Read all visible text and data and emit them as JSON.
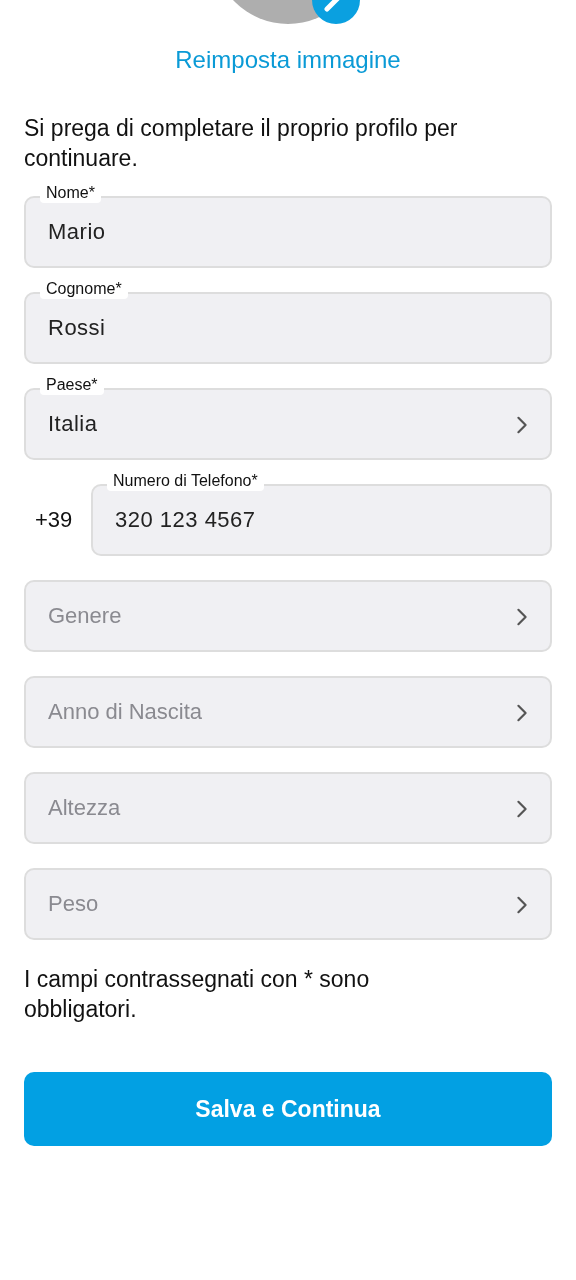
{
  "header": {
    "reset_link": "Reimposta immagine"
  },
  "intro": "Si prega di completare il proprio profilo per continuare.",
  "fields": [
    {
      "kind": "text",
      "label": "Nome*",
      "value": "Mario"
    },
    {
      "kind": "text",
      "label": "Cognome*",
      "value": "Rossi"
    },
    {
      "kind": "select",
      "label": "Paese*",
      "value": "Italia"
    },
    {
      "kind": "phone",
      "prefix": "+39",
      "label": "Numero di Telefono*",
      "value": "320 123 4567"
    },
    {
      "kind": "select",
      "placeholder": "Genere"
    },
    {
      "kind": "select",
      "placeholder": "Anno di Nascita"
    },
    {
      "kind": "select",
      "placeholder": "Altezza"
    },
    {
      "kind": "select",
      "placeholder": "Peso"
    }
  ],
  "note": "I campi contrassegnati con * sono obbligatori.",
  "save_button": "Salva e Continua"
}
